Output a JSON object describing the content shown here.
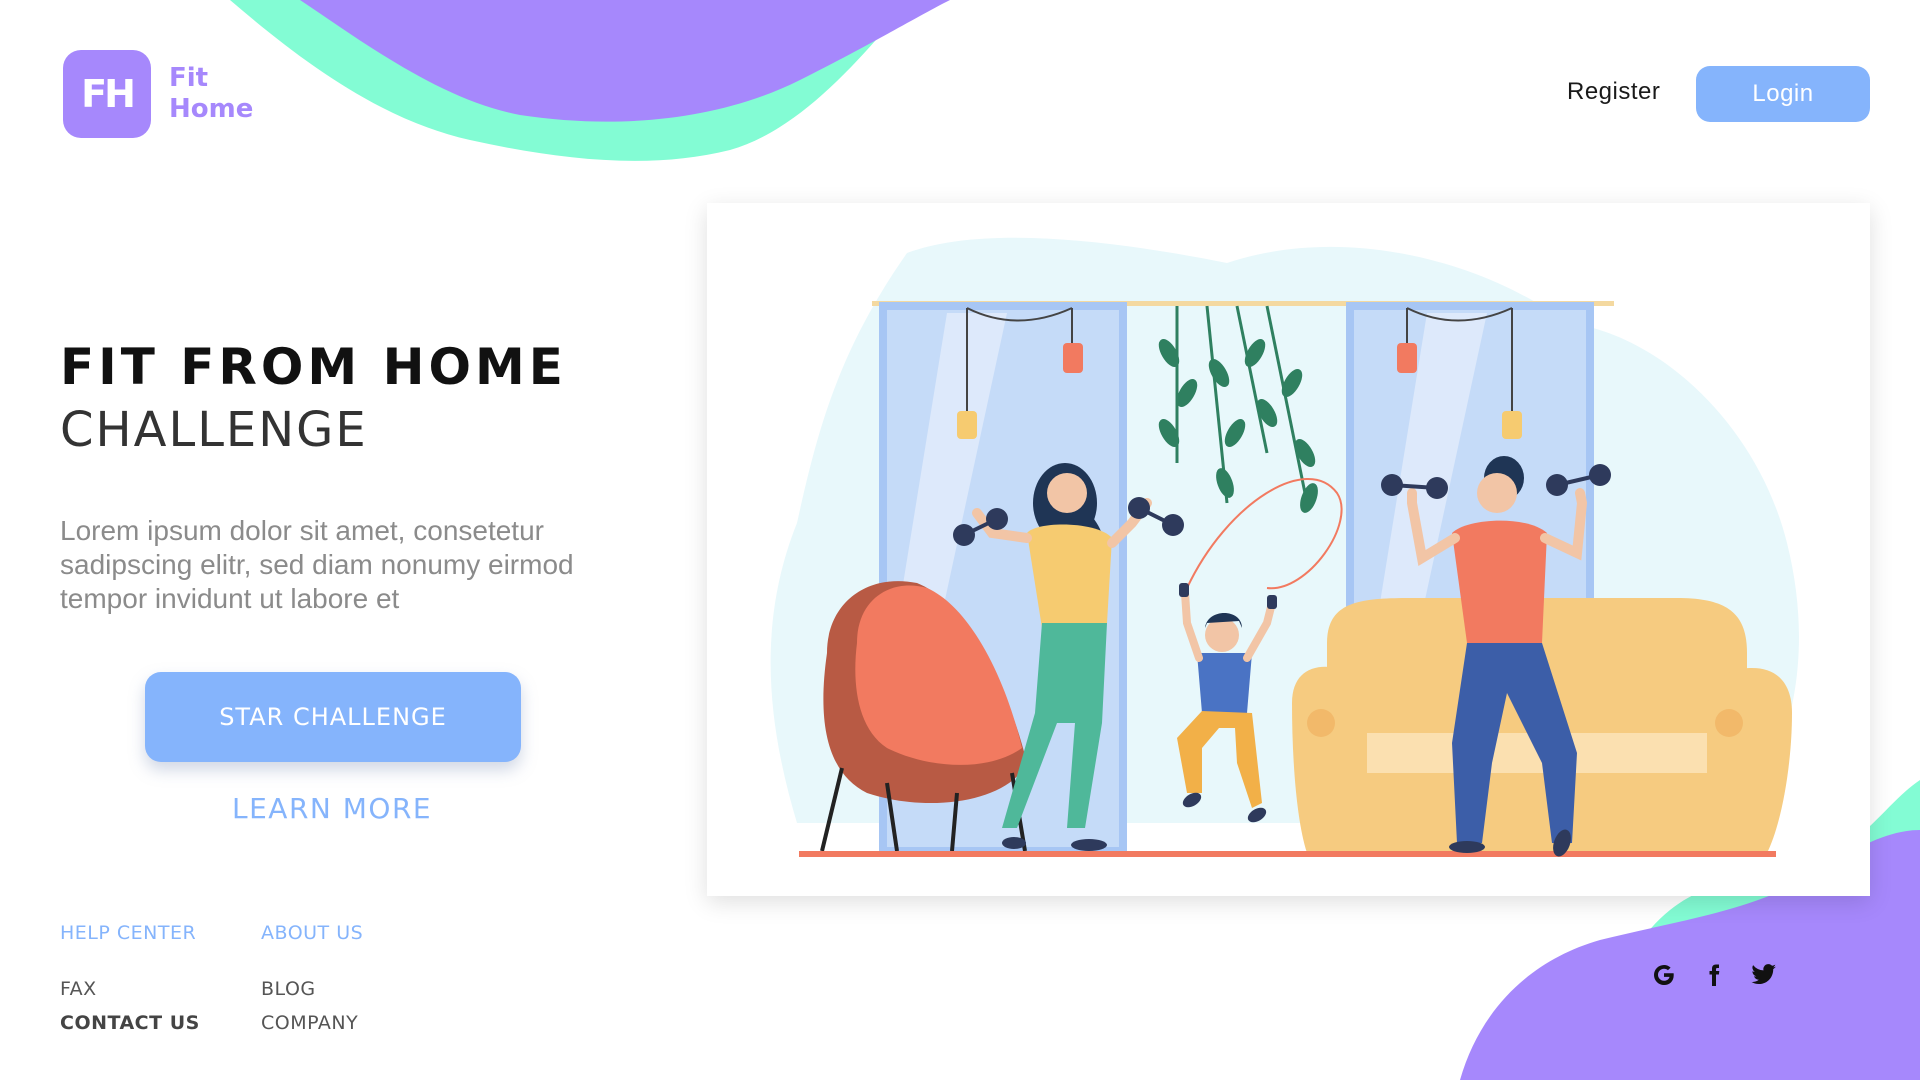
{
  "brand": {
    "logo_initials": "FH",
    "name_line1": "Fit",
    "name_line2": "Home"
  },
  "header": {
    "register_label": "Register",
    "login_label": "Login"
  },
  "hero": {
    "title": "FIT FROM HOME",
    "subtitle": "CHALLENGE",
    "description": "Lorem ipsum dolor sit amet, consetetur sadipscing elitr, sed diam nonumy eirmod tempor invidunt ut labore et",
    "primary_button": "STAR CHALLENGE",
    "secondary_link": "LEARN MORE"
  },
  "footer": {
    "columns": [
      {
        "heading": "HELP CENTER",
        "links": [
          "FAX",
          "CONTACT US"
        ]
      },
      {
        "heading": "ABOUT US",
        "links": [
          "BLOG",
          "COMPANY"
        ]
      }
    ],
    "social": [
      "google-icon",
      "facebook-icon",
      "twitter-icon"
    ]
  },
  "colors": {
    "purple": "#a688fc",
    "mint": "#83fcd4",
    "blue": "#85b4fc",
    "text_dark": "#111111",
    "text_gray": "#8b8b8b"
  }
}
